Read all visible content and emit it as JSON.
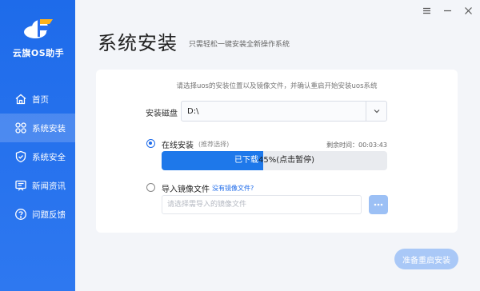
{
  "app": {
    "logo_text": "云旗OS助手",
    "window_controls": [
      "menu-icon",
      "minimize-icon",
      "close-icon"
    ]
  },
  "sidebar": {
    "items": [
      {
        "label": "首页",
        "icon": "home-icon",
        "active": false
      },
      {
        "label": "系统安装",
        "icon": "apps-icon",
        "active": true
      },
      {
        "label": "系统安全",
        "icon": "shield-icon",
        "active": false
      },
      {
        "label": "新闻资讯",
        "icon": "news-icon",
        "active": false
      },
      {
        "label": "问题反馈",
        "icon": "question-icon",
        "active": false
      }
    ]
  },
  "header": {
    "title": "系统安装",
    "subtitle": "只需轻松一键安装全新操作系统"
  },
  "card": {
    "hint": "请选择uos的安装位置以及镜像文件，并确认重启开始安装uos系统",
    "disk_label": "安装磁盘",
    "disk_value": "D:\\",
    "online": {
      "label": "在线安装",
      "tag": "(推荐选择)",
      "selected": true,
      "remaining": "剩余时间：00:03:43",
      "progress_percent": 45,
      "progress_text_light": "已下载",
      "progress_text_dark": "45%(点击暂停)"
    },
    "image": {
      "label": "导入镜像文件",
      "link": "没有镜像文件?",
      "selected": false,
      "placeholder": "请选择需导入的镜像文件",
      "value": ""
    }
  },
  "footer": {
    "restart_label": "准备重启安装"
  },
  "colors": {
    "primary": "#1e6bea",
    "sidebar": "#2e78f0",
    "progress_fill": "#1e78ea",
    "disabled_button": "#a9c8f7"
  }
}
